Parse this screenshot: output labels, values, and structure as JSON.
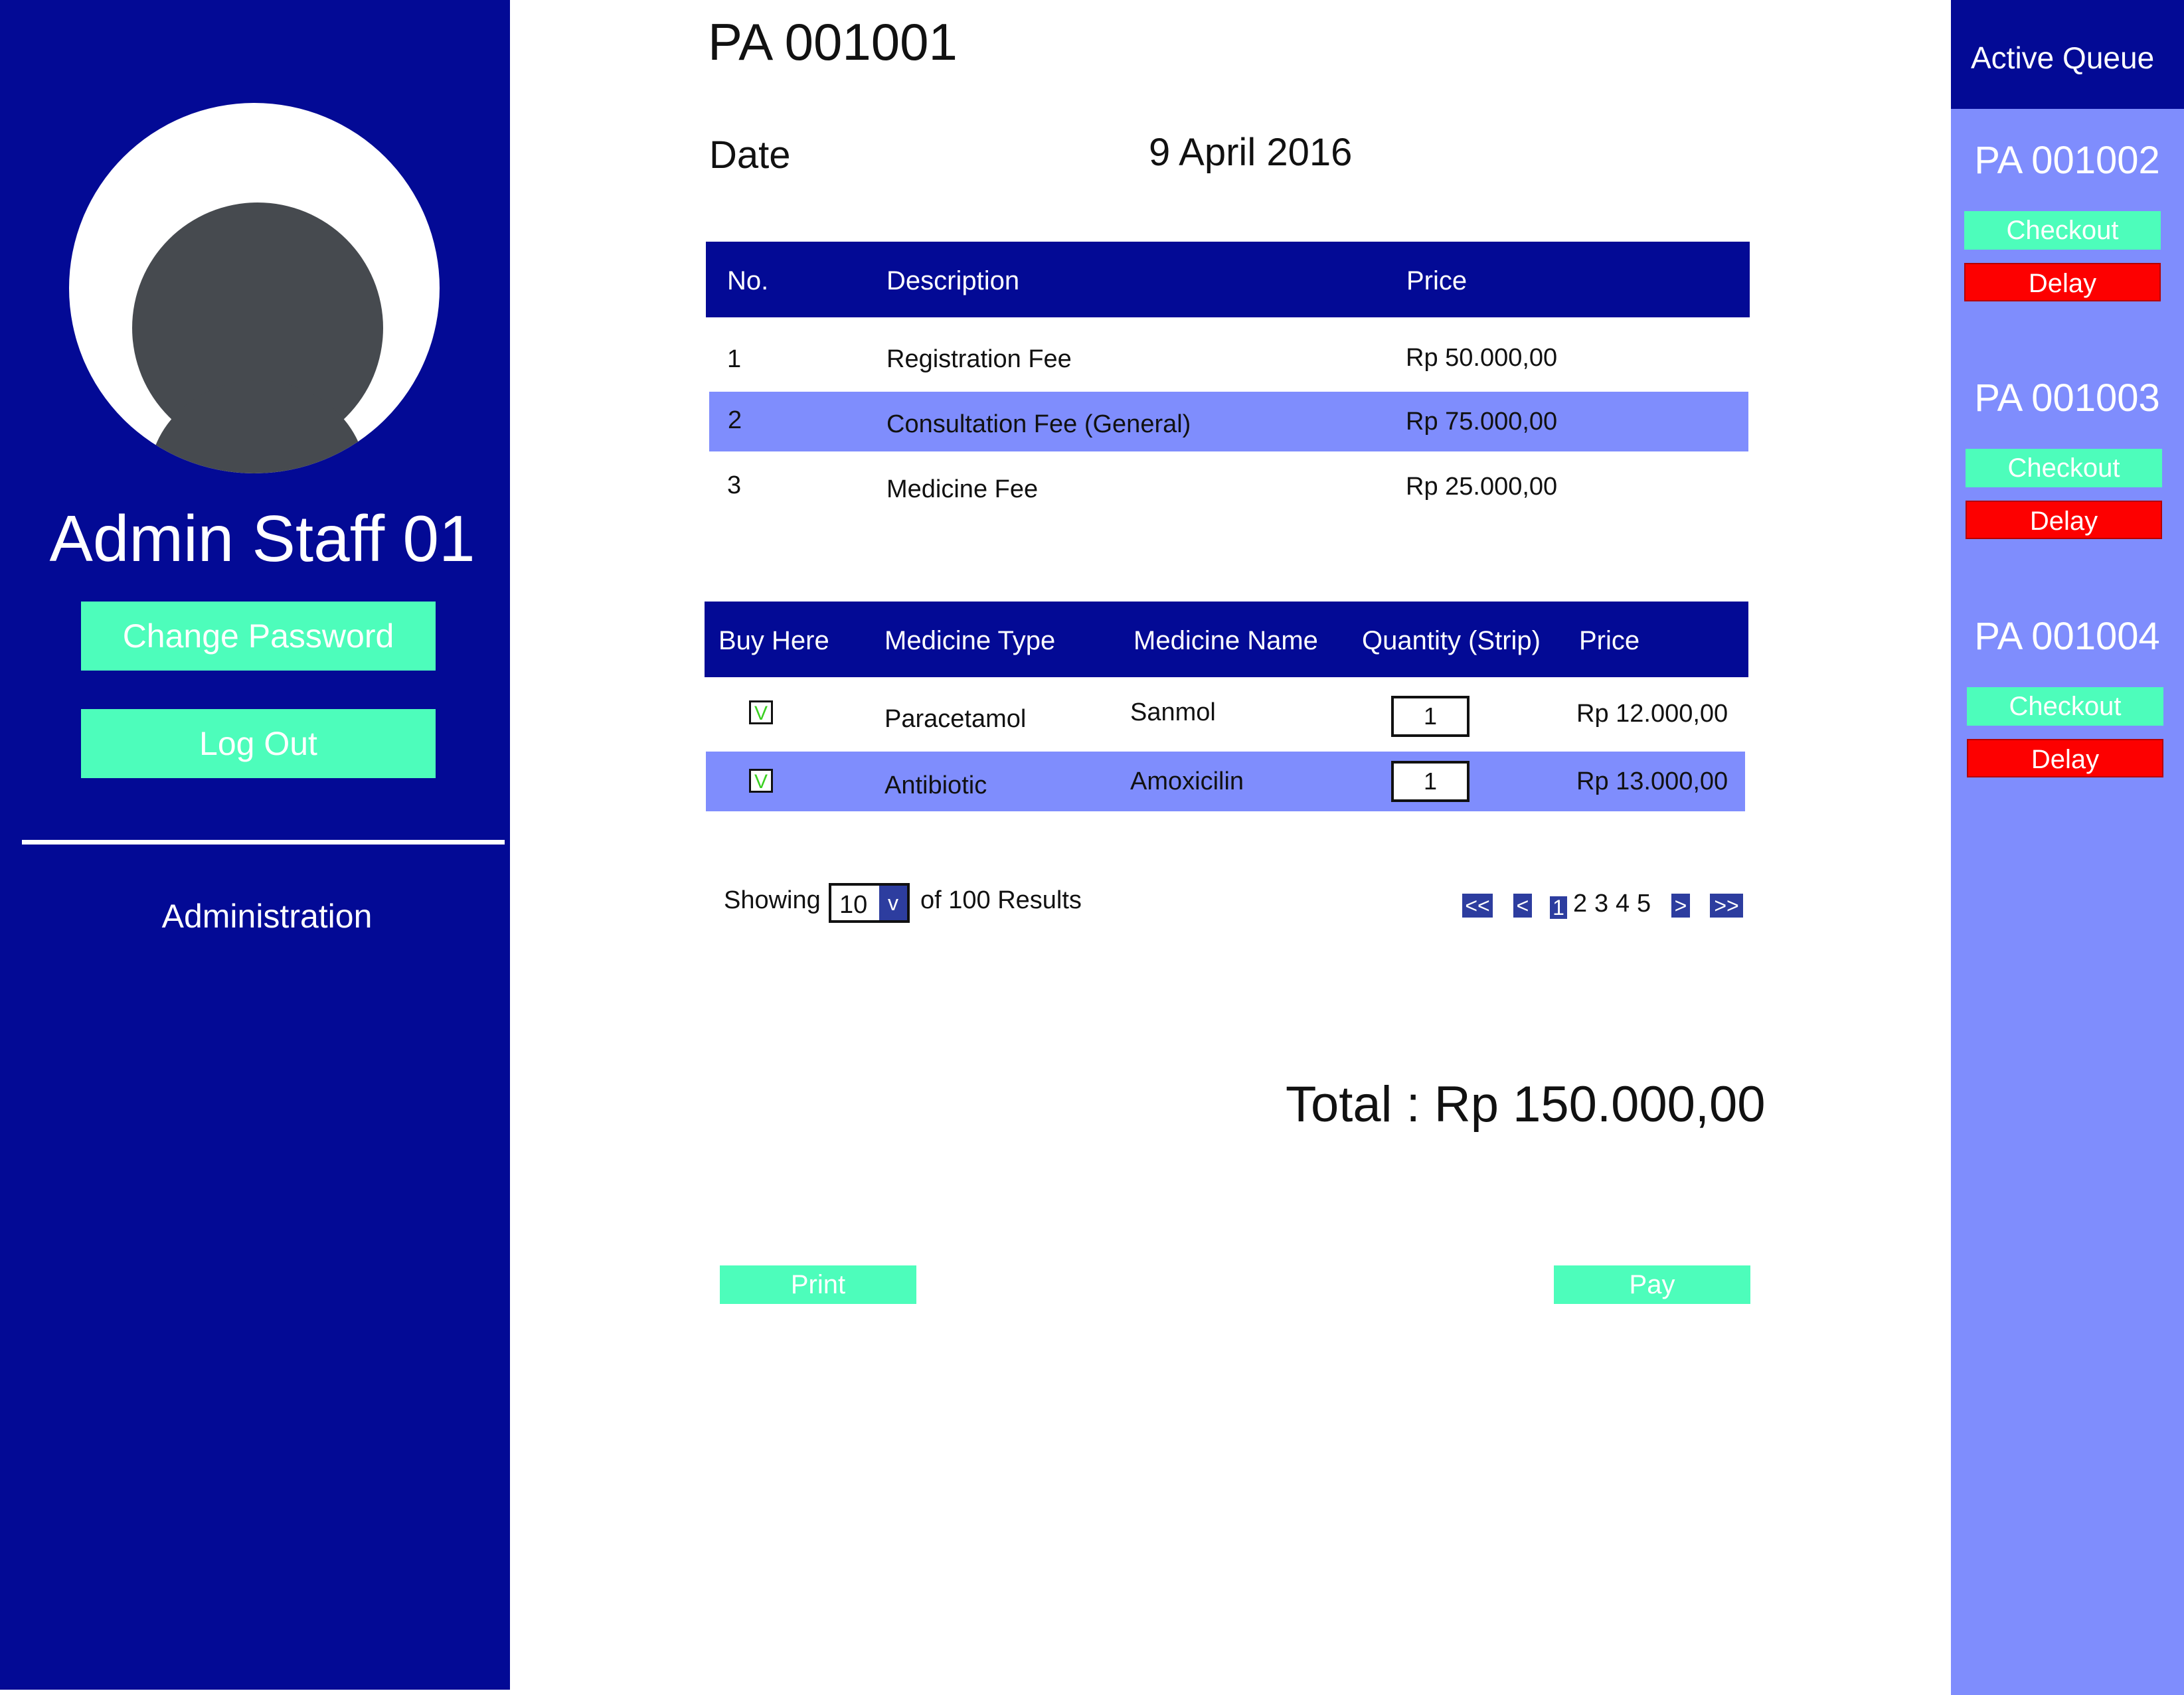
{
  "sidebar": {
    "user_name": "Admin Staff 01",
    "change_password_label": "Change Password",
    "logout_label": "Log Out",
    "nav_items": [
      {
        "label": "Administration"
      }
    ]
  },
  "invoice": {
    "id": "PA 001001",
    "date_label": "Date",
    "date_value": "9 April 2016"
  },
  "fees_table": {
    "headers": [
      "No.",
      "Description",
      "Price"
    ],
    "rows": [
      {
        "no": "1",
        "description": "Registration Fee",
        "price": "Rp 50.000,00"
      },
      {
        "no": "2",
        "description": "Consultation Fee (General)",
        "price": "Rp 75.000,00"
      },
      {
        "no": "3",
        "description": "Medicine Fee",
        "price": "Rp 25.000,00"
      }
    ]
  },
  "medicine_table": {
    "headers": [
      "Buy Here",
      "Medicine Type",
      "Medicine Name",
      "Quantity (Strip)",
      "Price"
    ],
    "rows": [
      {
        "check": "V",
        "type": "Paracetamol",
        "name": "Sanmol",
        "quantity": "1",
        "price": "Rp 12.000,00"
      },
      {
        "check": "V",
        "type": "Antibiotic",
        "name": "Amoxicilin",
        "quantity": "1",
        "price": "Rp 13.000,00"
      }
    ]
  },
  "pagination": {
    "showing_label": "Showing",
    "page_size": "10",
    "dropdown_glyph": "v",
    "of_results_label": "of 100 Results",
    "first": "<<",
    "prev": "<",
    "pages": [
      "1",
      "2",
      "3",
      "4",
      "5"
    ],
    "current_page": "1",
    "next": ">",
    "last": ">>"
  },
  "total_label": "Total : Rp 150.000,00",
  "actions": {
    "print_label": "Print",
    "pay_label": "Pay"
  },
  "queue": {
    "title": "Active Queue",
    "items": [
      {
        "id": "PA 001002",
        "checkout_label": "Checkout",
        "delay_label": "Delay"
      },
      {
        "id": "PA 001003",
        "checkout_label": "Checkout",
        "delay_label": "Delay"
      },
      {
        "id": "PA 001004",
        "checkout_label": "Checkout",
        "delay_label": "Delay"
      }
    ]
  },
  "colors": {
    "primary_navy": "#030a95",
    "accent_mint": "#4dfdbb",
    "row_highlight": "#7f8dfd",
    "delay_red": "#fd0000",
    "pager_blue": "#2d3d9f"
  }
}
